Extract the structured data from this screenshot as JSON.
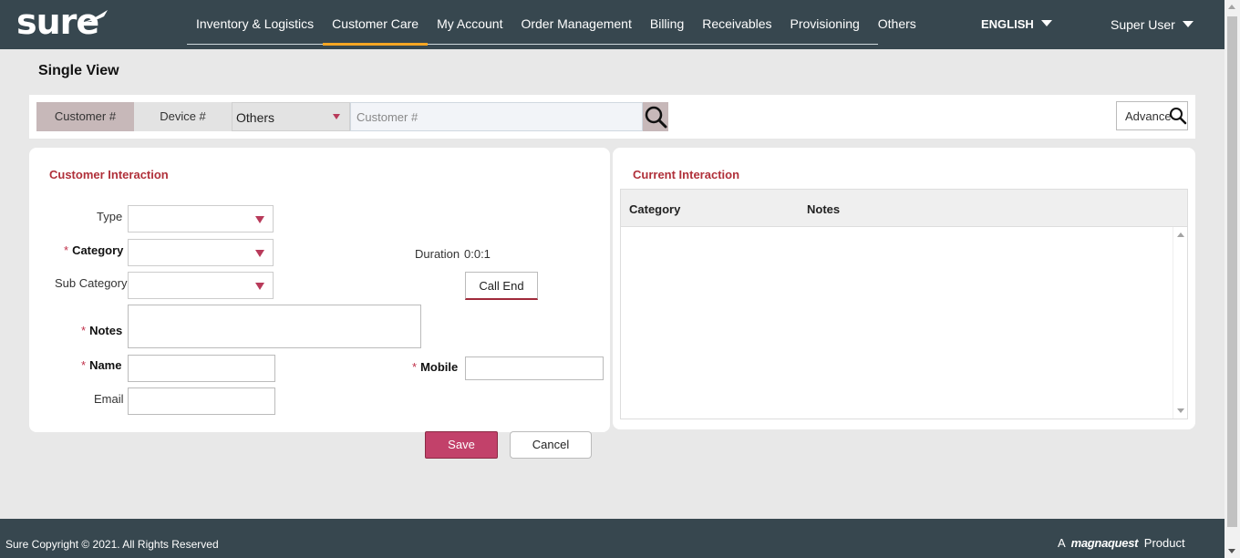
{
  "brand": {
    "logo_text": "sure"
  },
  "nav": {
    "items": [
      {
        "label": "Inventory & Logistics",
        "active": false
      },
      {
        "label": "Customer Care",
        "active": true
      },
      {
        "label": "My Account",
        "active": false
      },
      {
        "label": "Order Management",
        "active": false
      },
      {
        "label": "Billing",
        "active": false
      },
      {
        "label": "Receivables",
        "active": false
      },
      {
        "label": "Provisioning",
        "active": false
      },
      {
        "label": "Others",
        "active": false
      }
    ],
    "language": "ENGLISH",
    "user": "Super User"
  },
  "page": {
    "title": "Single View"
  },
  "search": {
    "tab_customer": "Customer #",
    "tab_device": "Device #",
    "type_selected": "Others",
    "placeholder": "Customer #",
    "value": "",
    "advance_label": "Advance"
  },
  "interaction": {
    "heading": "Customer Interaction",
    "type_label": "Type",
    "category_label": "Category",
    "subcategory_label": "Sub Category",
    "notes_label": "Notes",
    "name_label": "Name",
    "email_label": "Email",
    "mobile_label": "Mobile",
    "duration_label": "Duration",
    "duration_value": "0:0:1",
    "call_end_label": "Call End",
    "required_mark": "*",
    "type_value": "",
    "category_value": "",
    "subcategory_value": "",
    "notes_value": "",
    "name_value": "",
    "email_value": "",
    "mobile_value": ""
  },
  "current": {
    "heading": "Current Interaction",
    "columns": [
      "Category",
      "Notes"
    ],
    "rows": []
  },
  "actions": {
    "save": "Save",
    "cancel": "Cancel"
  },
  "footer": {
    "copyright": "Sure Copyright © 2021. All Rights Reserved",
    "product_prefix": "A",
    "product_brand": "magnaquest",
    "product_suffix": "Product"
  },
  "colors": {
    "header_bg": "#37474f",
    "accent_orange": "#f5a623",
    "accent_red": "#b0303a",
    "save_button": "#c2416a"
  }
}
